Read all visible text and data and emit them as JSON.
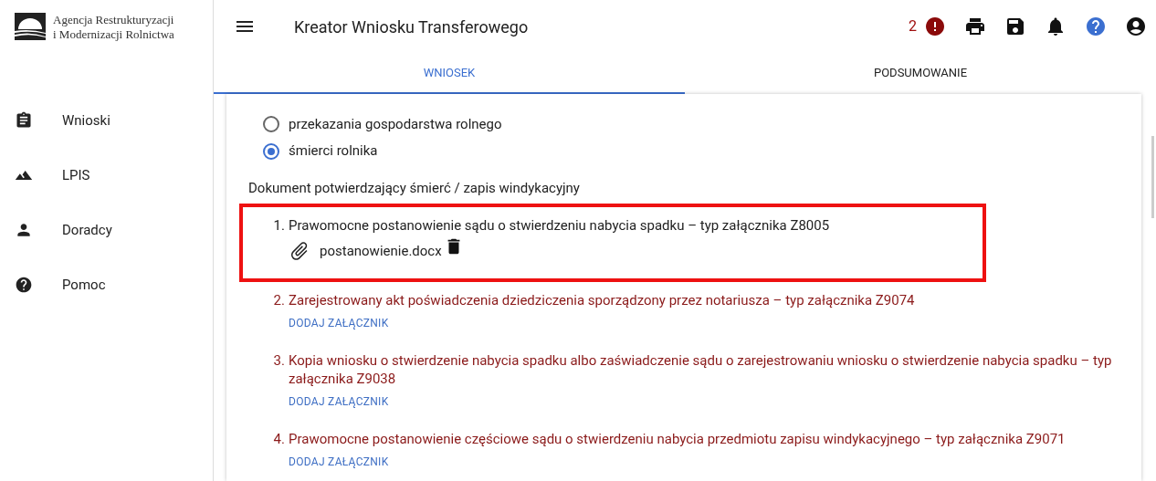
{
  "logo": {
    "lines": [
      "Agencja Restrukturyzacji",
      "i Modernizacji Rolnictwa"
    ]
  },
  "sidebar": {
    "items": [
      {
        "label": "Wnioski"
      },
      {
        "label": "LPIS"
      },
      {
        "label": "Doradcy"
      },
      {
        "label": "Pomoc"
      }
    ]
  },
  "header": {
    "title": "Kreator Wniosku Transferowego",
    "error_count": "2"
  },
  "tabs": [
    {
      "label": "WNIOSEK",
      "selected": true
    },
    {
      "label": "PODSUMOWANIE",
      "selected": false
    }
  ],
  "radios": [
    {
      "label": "przekazania gospodarstwa rolnego",
      "selected": false
    },
    {
      "label": "śmierci rolnika",
      "selected": true
    }
  ],
  "section_label": "Dokument potwierdzający śmierć / zapis windykacyjny",
  "documents": [
    {
      "number": "1.",
      "text": "Prawomocne postanowienie sądu o stwierdzeniu nabycia spadku – typ załącznika Z8005",
      "kind": "attached",
      "file": "postanowienie.docx",
      "highlighted": true
    },
    {
      "number": "2.",
      "text": "Zarejestrowany akt poświadczenia dziedziczenia sporządzony przez notariusza – typ załącznika Z9074",
      "kind": "missing",
      "action": "DODAJ ZAŁĄCZNIK",
      "highlighted": false
    },
    {
      "number": "3.",
      "text": "Kopia wniosku o stwierdzenie nabycia spadku albo zaświadczenie sądu o zarejestrowaniu wniosku o stwierdzenie nabycia spadku – typ załącznika Z9038",
      "kind": "missing",
      "action": "DODAJ ZAŁĄCZNIK",
      "highlighted": false
    },
    {
      "number": "4.",
      "text": "Prawomocne postanowienie częściowe sądu o stwierdzeniu nabycia przedmiotu zapisu windykacyjnego – typ załącznika Z9071",
      "kind": "missing",
      "action": "DODAJ ZAŁĄCZNIK",
      "highlighted": false
    }
  ]
}
